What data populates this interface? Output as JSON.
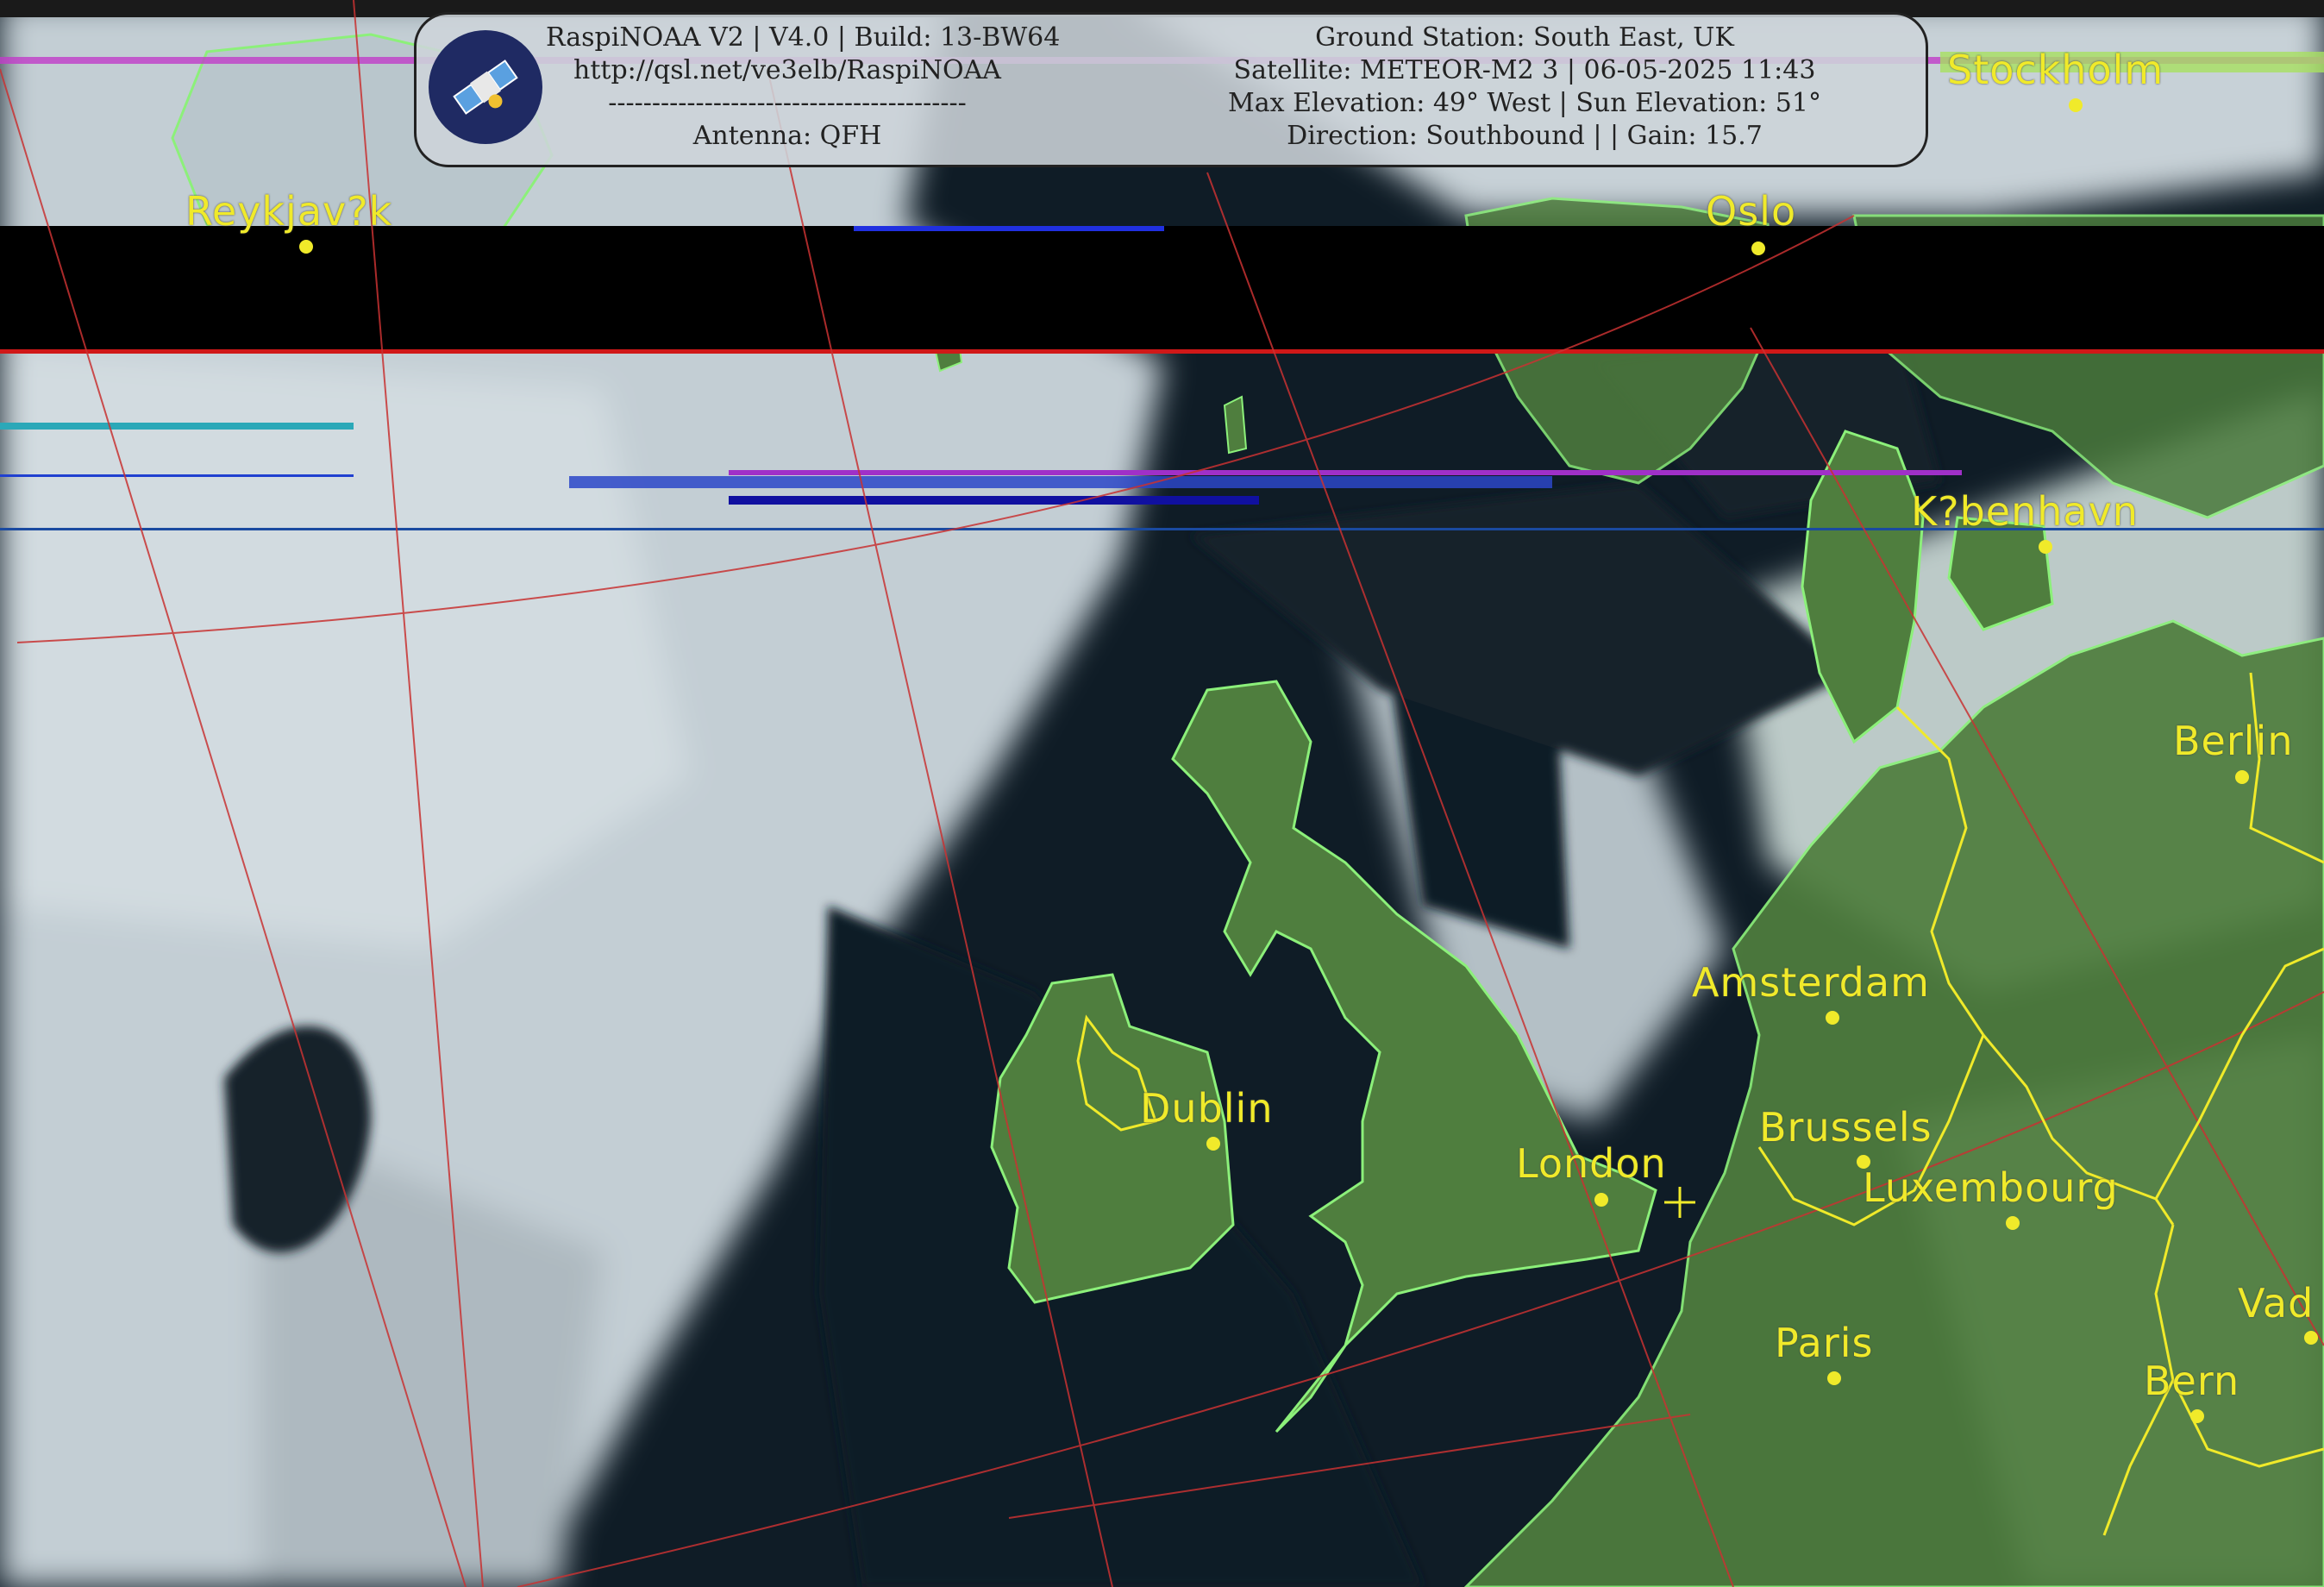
{
  "header": {
    "left_lines": [
      "RaspiNOAA V2 | V4.0 | Build: 13-BW64",
      "http://qsl.net/ve3elb/RaspiNOAA",
      "-----------------------------------------",
      "Antenna: QFH"
    ],
    "right_lines": [
      "Ground Station: South East, UK",
      "Satellite: METEOR-M2 3 | 06-05-2025 11:43",
      "Max Elevation: 49° West | Sun Elevation: 51°",
      "Direction: Southbound | | Gain: 15.7"
    ]
  },
  "colors": {
    "label": "#f0ea2a",
    "coast": "#8cf07a",
    "border": "#f0ea2a",
    "grid": "#c83232",
    "sea": "#0f1c26",
    "cloud": "#c9d3d9",
    "land": "#4f7e3e"
  },
  "cities": [
    {
      "name": "Reykjav?k"
    },
    {
      "name": "Stockholm"
    },
    {
      "name": "Oslo"
    },
    {
      "name": "K?benhavn"
    },
    {
      "name": "Berlin"
    },
    {
      "name": "Amsterdam"
    },
    {
      "name": "Dublin"
    },
    {
      "name": "Brussels"
    },
    {
      "name": "London"
    },
    {
      "name": "Luxembourg"
    },
    {
      "name": "Paris"
    },
    {
      "name": "Bern"
    },
    {
      "name": "Vad"
    }
  ]
}
